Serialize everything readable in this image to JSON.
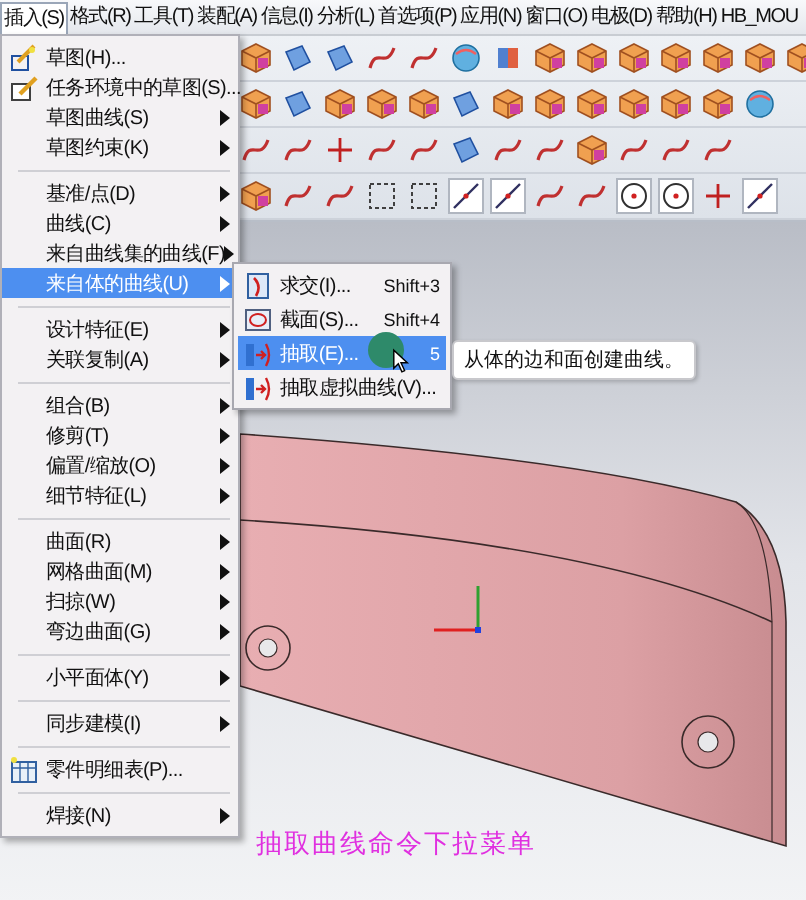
{
  "menu_bar": [
    {
      "label": "插入(S)",
      "selected": true
    },
    {
      "label": "格式(R)",
      "selected": false
    },
    {
      "label": "工具(T)",
      "selected": false
    },
    {
      "label": "装配(A)",
      "selected": false
    },
    {
      "label": "信息(I)",
      "selected": false
    },
    {
      "label": "分析(L)",
      "selected": false
    },
    {
      "label": "首选项(P)",
      "selected": false
    },
    {
      "label": "应用(N)",
      "selected": false
    },
    {
      "label": "窗口(O)",
      "selected": false
    },
    {
      "label": "电极(D)",
      "selected": false
    },
    {
      "label": "帮助(H)",
      "selected": false
    },
    {
      "label": "HB_MOU",
      "selected": false
    }
  ],
  "dropdown": {
    "items": [
      {
        "kind": "command",
        "label": "草图(H)...",
        "selected": false
      },
      {
        "kind": "command",
        "label": "任务环境中的草图(S)...",
        "selected": false
      },
      {
        "kind": "submenu",
        "label": "草图曲线(S)",
        "selected": false
      },
      {
        "kind": "submenu",
        "label": "草图约束(K)",
        "selected": false
      },
      {
        "kind": "separator"
      },
      {
        "kind": "submenu",
        "label": "基准/点(D)",
        "selected": false
      },
      {
        "kind": "submenu",
        "label": "曲线(C)",
        "selected": false
      },
      {
        "kind": "submenu",
        "label": "来自曲线集的曲线(F)",
        "selected": false
      },
      {
        "kind": "submenu",
        "label": "来自体的曲线(U)",
        "selected": true
      },
      {
        "kind": "separator"
      },
      {
        "kind": "submenu",
        "label": "设计特征(E)",
        "selected": false
      },
      {
        "kind": "submenu",
        "label": "关联复制(A)",
        "selected": false
      },
      {
        "kind": "separator"
      },
      {
        "kind": "submenu",
        "label": "组合(B)",
        "selected": false
      },
      {
        "kind": "submenu",
        "label": "修剪(T)",
        "selected": false
      },
      {
        "kind": "submenu",
        "label": "偏置/缩放(O)",
        "selected": false
      },
      {
        "kind": "submenu",
        "label": "细节特征(L)",
        "selected": false
      },
      {
        "kind": "separator"
      },
      {
        "kind": "submenu",
        "label": "曲面(R)",
        "selected": false
      },
      {
        "kind": "submenu",
        "label": "网格曲面(M)",
        "selected": false
      },
      {
        "kind": "submenu",
        "label": "扫掠(W)",
        "selected": false
      },
      {
        "kind": "submenu",
        "label": "弯边曲面(G)",
        "selected": false
      },
      {
        "kind": "separator"
      },
      {
        "kind": "submenu",
        "label": "小平面体(Y)",
        "selected": false
      },
      {
        "kind": "separator"
      },
      {
        "kind": "submenu",
        "label": "同步建模(I)",
        "selected": false
      },
      {
        "kind": "separator"
      },
      {
        "kind": "command",
        "label": "零件明细表(P)...",
        "selected": false
      },
      {
        "kind": "separator"
      },
      {
        "kind": "submenu",
        "label": "焊接(N)",
        "selected": false
      }
    ]
  },
  "submenu": {
    "items": [
      {
        "label": "求交(I)...",
        "shortcut": "Shift+3",
        "selected": false
      },
      {
        "label": "截面(S)...",
        "shortcut": "Shift+4",
        "selected": false
      },
      {
        "label": "抽取(E)...",
        "shortcut": "5",
        "selected": true
      },
      {
        "label": "抽取虚拟曲线(V)...",
        "selected": false
      }
    ]
  },
  "tooltip": "从体的边和面创建曲线。",
  "caption": "抽取曲线命令下拉菜单"
}
